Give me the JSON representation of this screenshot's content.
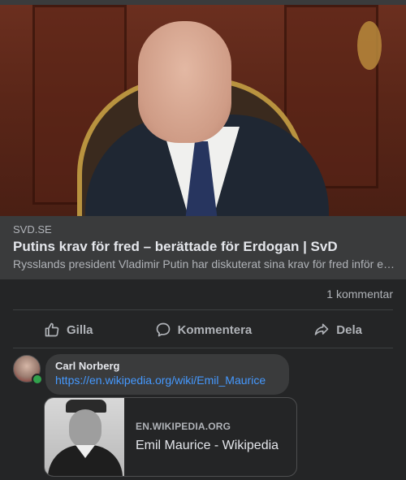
{
  "link_preview": {
    "domain": "SVD.SE",
    "title": "Putins krav för fred – berättade för Erdogan | SvD",
    "description": "Rysslands president Vladimir Putin har diskuterat sina krav för fred inför ett möte"
  },
  "stats": {
    "comments": "1 kommentar"
  },
  "actions": {
    "like": "Gilla",
    "comment": "Kommentera",
    "share": "Dela"
  },
  "comment": {
    "author": "Carl Norberg",
    "link": "https://en.wikipedia.org/wiki/Emil_Maurice",
    "preview": {
      "domain": "EN.WIKIPEDIA.ORG",
      "title": "Emil Maurice - Wikipedia"
    }
  },
  "colors": {
    "background": "#242526",
    "surface": "#3a3b3c",
    "link": "#4599ff",
    "online": "#31a24c"
  },
  "icons": [
    "like-icon",
    "comment-icon",
    "share-icon"
  ]
}
